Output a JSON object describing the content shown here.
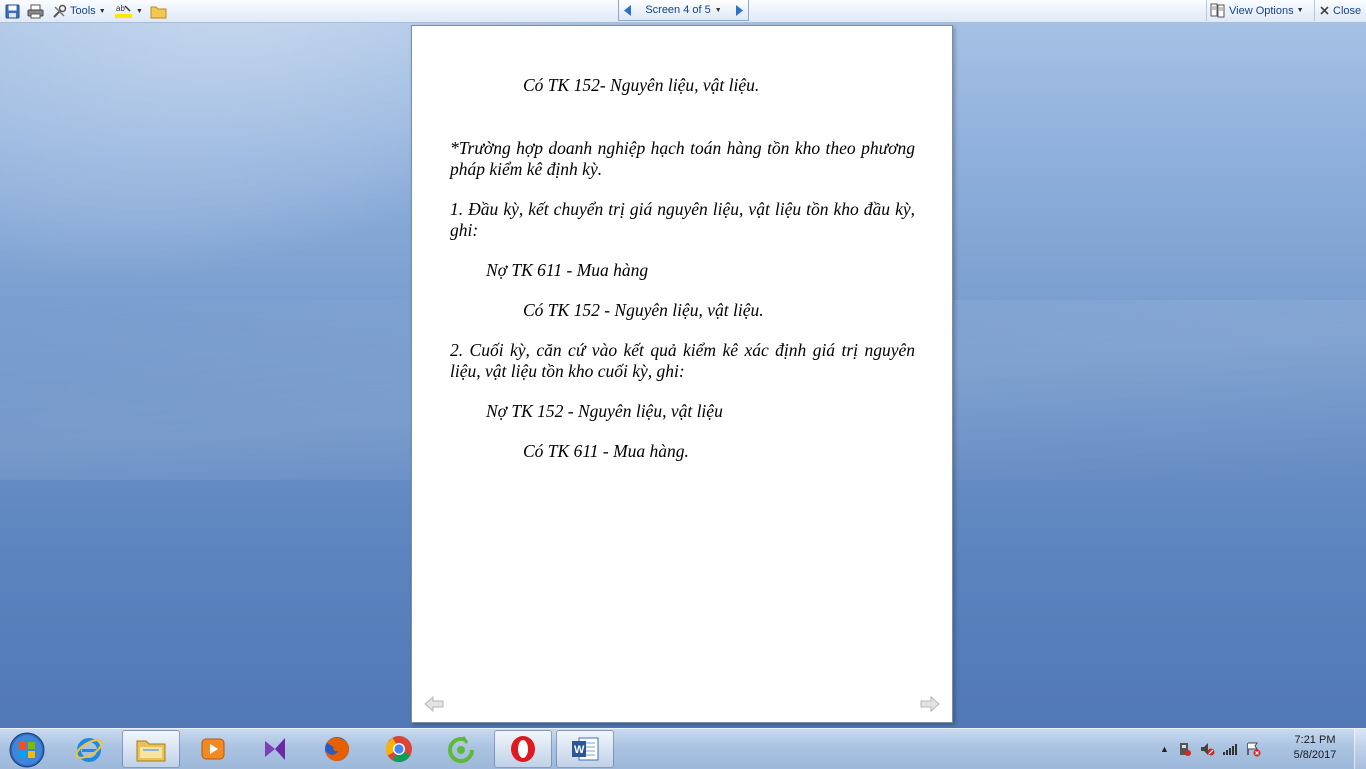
{
  "toolbar": {
    "tools_label": "Tools",
    "screen_label": "Screen 4 of 5",
    "view_options_label": "View Options",
    "close_label": "Close"
  },
  "document": {
    "lines": [
      "Có  TK 152- Nguyên liệu, vật liệu.",
      " *Trường hợp doanh nghiệp hạch toán hàng tồn kho theo phương pháp kiểm kê định kỳ.",
      "1. Đầu kỳ, kết chuyển trị giá nguyên liệu, vật liệu tồn kho đầu kỳ, ghi:",
      "Nợ TK 611 - Mua hàng",
      "Có TK 152 - Nguyên liệu, vật liệu.",
      "2. Cuối kỳ, căn cứ vào kết quả kiểm kê xác định giá trị nguyên liệu, vật liệu tồn kho cuối kỳ, ghi:",
      "Nợ TK 152 - Nguyên liệu, vật liệu",
      "Có TK 611 - Mua hàng."
    ]
  },
  "taskbar": {
    "apps": [
      "windows-explorer",
      "media-player",
      "visual-studio",
      "firefox",
      "chrome",
      "coc-coc",
      "opera",
      "microsoft-word"
    ],
    "clock_time": "7:21 PM",
    "clock_date": "5/8/2017"
  },
  "colors": {
    "toolbar_text": "#15428b",
    "desktop_top": "#a9c4e6",
    "desktop_bottom": "#4f76b3"
  }
}
